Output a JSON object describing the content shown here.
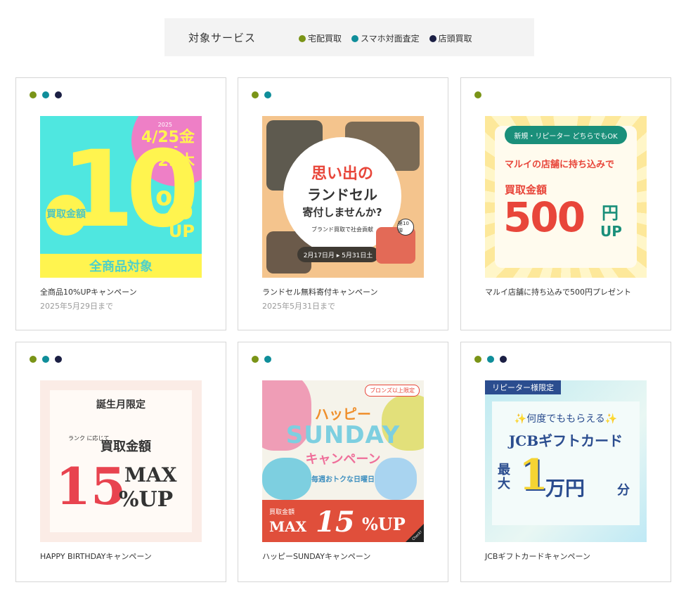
{
  "legend": {
    "title": "対象サービス",
    "items": [
      {
        "label": "宅配買取",
        "color": "#7a9417"
      },
      {
        "label": "スマホ対面査定",
        "color": "#0f8e9a"
      },
      {
        "label": "店頭買取",
        "color": "#1b1f44"
      }
    ]
  },
  "cards": [
    {
      "title": "全商品10%UPキャンペーン",
      "subtitle": "2025年5月29日まで",
      "services": [
        "宅配買取",
        "スマホ対面査定",
        "店頭買取"
      ],
      "banner": {
        "year": "2025",
        "date_start": "4/25金",
        "dash": "-",
        "date_end": "5/29木",
        "circle": "買取金額",
        "big": "10",
        "pct": "%",
        "up": "UP",
        "foot": "全商品対象"
      }
    },
    {
      "title": "ランドセル無料寄付キャンペーン",
      "subtitle": "2025年5月31日まで",
      "services": [
        "宅配買取",
        "スマホ対面査定"
      ],
      "banner": {
        "line1": "思い出の",
        "line2": "ランドセル",
        "line3": "寄付しませんか?",
        "line4": "ブランド買取で社会貢献",
        "dates": "2月17日月 ▸ 5月31日土",
        "badge": "第10弾"
      }
    },
    {
      "title": "マルイ店舗に持ち込みで500円プレゼント",
      "subtitle": "",
      "services": [
        "宅配買取"
      ],
      "banner": {
        "pill": "新規・リピーター どちらでもOK",
        "line1": "マルイの店舗に持ち込みで",
        "line2": "買取金額",
        "amount": "500",
        "yen": "円",
        "up": "UP"
      }
    },
    {
      "title": "HAPPY BIRTHDAYキャンペーン",
      "subtitle": "",
      "services": [
        "宅配買取",
        "スマホ対面査定",
        "店頭買取"
      ],
      "banner": {
        "line1": "誕生月限定",
        "line2a": "ランク に応じて",
        "line2": "買取金額",
        "num": "15",
        "max": "MAX",
        "pup": "%UP"
      }
    },
    {
      "title": "ハッピーSUNDAYキャンペーン",
      "subtitle": "",
      "services": [
        "宅配買取",
        "スマホ対面査定"
      ],
      "banner": {
        "tag": "ブロンズ以上限定",
        "hap": "ハッピー",
        "sun": "SUNDAY",
        "cam": "キャンペーン",
        "week": "毎週おトクな日曜日",
        "bk": "買取金額",
        "bmax": "MAX",
        "b15": "15",
        "bup": "%UP",
        "check": "Check!"
      }
    },
    {
      "title": "JCBギフトカードキャンペーン",
      "subtitle": "",
      "services": [
        "宅配買取",
        "スマホ対面査定",
        "店頭買取"
      ],
      "banner": {
        "tag": "リピーター様限定",
        "line1": "✨何度でももらえる✨",
        "line2": "JCBギフトカード",
        "max": "最大",
        "one": "1",
        "man": "万円",
        "bun": "分"
      }
    }
  ]
}
